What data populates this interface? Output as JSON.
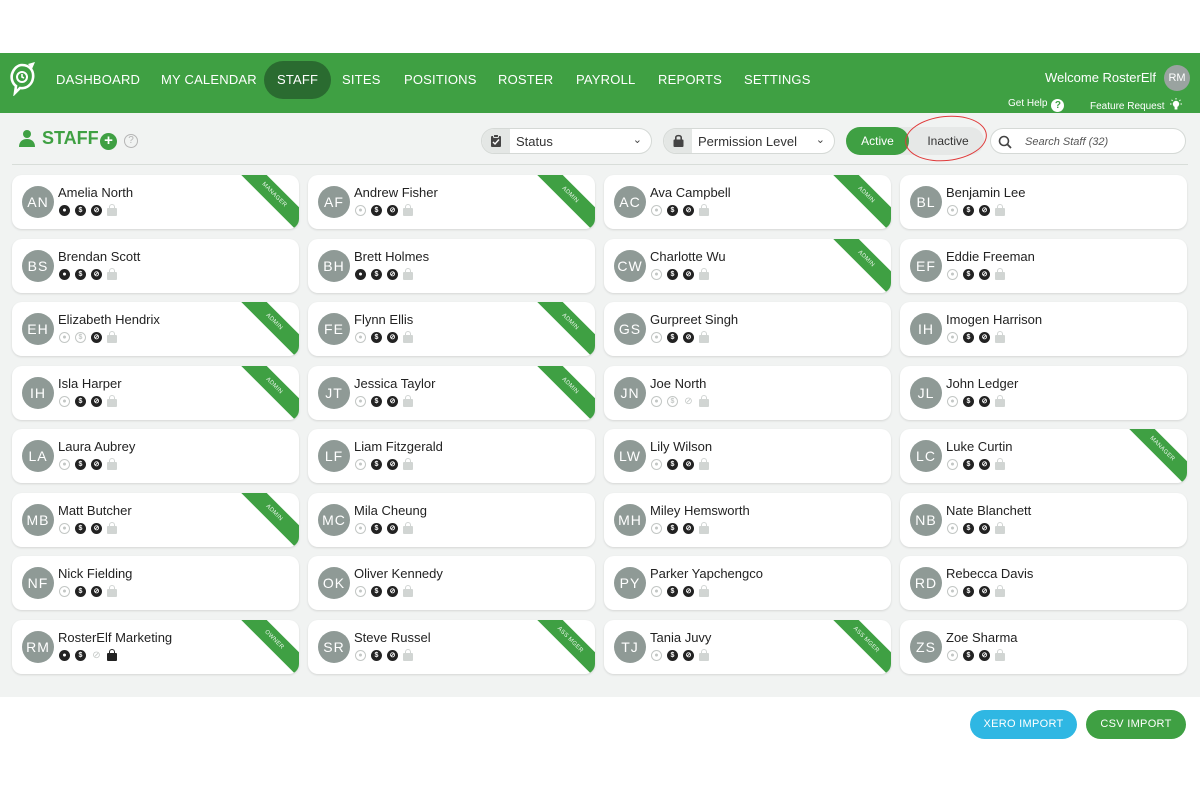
{
  "nav": {
    "items": [
      "DASHBOARD",
      "MY CALENDAR",
      "STAFF",
      "SITES",
      "POSITIONS",
      "ROSTER",
      "PAYROLL",
      "REPORTS",
      "SETTINGS"
    ],
    "active": "STAFF",
    "welcome": "Welcome RosterElf",
    "avatar_initials": "RM",
    "get_help": "Get Help",
    "feature_request": "Feature Request"
  },
  "toolbar": {
    "title": "STAFF",
    "status_label": "Status",
    "permission_label": "Permission Level",
    "active_label": "Active",
    "inactive_label": "Inactive",
    "search_placeholder": "Search Staff (32)"
  },
  "staff": [
    {
      "initials": "AN",
      "name": "Amelia North",
      "icons": [
        "on",
        "on",
        "on",
        "lock-off"
      ],
      "ribbon": "MANAGER"
    },
    {
      "initials": "AF",
      "name": "Andrew Fisher",
      "icons": [
        "off",
        "on",
        "on",
        "lock-off"
      ],
      "ribbon": "ADMIN"
    },
    {
      "initials": "AC",
      "name": "Ava Campbell",
      "icons": [
        "off",
        "on",
        "on",
        "lock-off"
      ],
      "ribbon": "ADMIN"
    },
    {
      "initials": "BL",
      "name": "Benjamin Lee",
      "icons": [
        "off",
        "on",
        "on",
        "lock-off"
      ],
      "ribbon": ""
    },
    {
      "initials": "BS",
      "name": "Brendan Scott",
      "icons": [
        "on",
        "on",
        "on",
        "lock-off"
      ],
      "ribbon": ""
    },
    {
      "initials": "BH",
      "name": "Brett Holmes",
      "icons": [
        "on",
        "on",
        "on",
        "lock-off"
      ],
      "ribbon": ""
    },
    {
      "initials": "CW",
      "name": "Charlotte Wu",
      "icons": [
        "off",
        "on",
        "on",
        "lock-off"
      ],
      "ribbon": "ADMIN"
    },
    {
      "initials": "EF",
      "name": "Eddie Freeman",
      "icons": [
        "off",
        "on",
        "on",
        "lock-off"
      ],
      "ribbon": ""
    },
    {
      "initials": "EH",
      "name": "Elizabeth Hendrix",
      "icons": [
        "off",
        "off",
        "on",
        "lock-off"
      ],
      "ribbon": "ADMIN"
    },
    {
      "initials": "FE",
      "name": "Flynn Ellis",
      "icons": [
        "off",
        "on",
        "on",
        "lock-off"
      ],
      "ribbon": "ADMIN"
    },
    {
      "initials": "GS",
      "name": "Gurpreet Singh",
      "icons": [
        "off",
        "on",
        "on",
        "lock-off"
      ],
      "ribbon": ""
    },
    {
      "initials": "IH",
      "name": "Imogen Harrison",
      "icons": [
        "off",
        "on",
        "on",
        "lock-off"
      ],
      "ribbon": ""
    },
    {
      "initials": "IH",
      "name": "Isla Harper",
      "icons": [
        "off",
        "on",
        "on",
        "lock-off"
      ],
      "ribbon": "ADMIN"
    },
    {
      "initials": "JT",
      "name": "Jessica Taylor",
      "icons": [
        "off",
        "on",
        "on",
        "lock-off"
      ],
      "ribbon": "ADMIN"
    },
    {
      "initials": "JN",
      "name": "Joe North",
      "icons": [
        "off",
        "off",
        "na",
        "lock-off"
      ],
      "ribbon": ""
    },
    {
      "initials": "JL",
      "name": "John Ledger",
      "icons": [
        "off",
        "on",
        "on",
        "lock-off"
      ],
      "ribbon": ""
    },
    {
      "initials": "LA",
      "name": "Laura Aubrey",
      "icons": [
        "off",
        "on",
        "on",
        "lock-off"
      ],
      "ribbon": ""
    },
    {
      "initials": "LF",
      "name": "Liam Fitzgerald",
      "icons": [
        "off",
        "on",
        "on",
        "lock-off"
      ],
      "ribbon": ""
    },
    {
      "initials": "LW",
      "name": "Lily Wilson",
      "icons": [
        "off",
        "on",
        "on",
        "lock-off"
      ],
      "ribbon": ""
    },
    {
      "initials": "LC",
      "name": "Luke Curtin",
      "icons": [
        "off",
        "on",
        "on",
        "lock-off"
      ],
      "ribbon": "MANAGER"
    },
    {
      "initials": "MB",
      "name": "Matt Butcher",
      "icons": [
        "off",
        "on",
        "on",
        "lock-off"
      ],
      "ribbon": "ADMIN"
    },
    {
      "initials": "MC",
      "name": "Mila Cheung",
      "icons": [
        "off",
        "on",
        "on",
        "lock-off"
      ],
      "ribbon": ""
    },
    {
      "initials": "MH",
      "name": "Miley Hemsworth",
      "icons": [
        "off",
        "on",
        "on",
        "lock-off"
      ],
      "ribbon": ""
    },
    {
      "initials": "NB",
      "name": "Nate Blanchett",
      "icons": [
        "off",
        "on",
        "on",
        "lock-off"
      ],
      "ribbon": ""
    },
    {
      "initials": "NF",
      "name": "Nick Fielding",
      "icons": [
        "off",
        "on",
        "on",
        "lock-off"
      ],
      "ribbon": ""
    },
    {
      "initials": "OK",
      "name": "Oliver Kennedy",
      "icons": [
        "off",
        "on",
        "on",
        "lock-off"
      ],
      "ribbon": ""
    },
    {
      "initials": "PY",
      "name": "Parker Yapchengco",
      "icons": [
        "off",
        "on",
        "on",
        "lock-off"
      ],
      "ribbon": ""
    },
    {
      "initials": "RD",
      "name": "Rebecca Davis",
      "icons": [
        "off",
        "on",
        "on",
        "lock-off"
      ],
      "ribbon": ""
    },
    {
      "initials": "RM",
      "name": "RosterElf Marketing",
      "icons": [
        "on",
        "on",
        "na",
        "lock-on"
      ],
      "ribbon": "OWNER"
    },
    {
      "initials": "SR",
      "name": "Steve Russel",
      "icons": [
        "off",
        "on",
        "on",
        "lock-off"
      ],
      "ribbon": "ASS MGER"
    },
    {
      "initials": "TJ",
      "name": "Tania Juvy",
      "icons": [
        "off",
        "on",
        "on",
        "lock-off"
      ],
      "ribbon": "ASS MGER"
    },
    {
      "initials": "ZS",
      "name": "Zoe Sharma",
      "icons": [
        "off",
        "on",
        "on",
        "lock-off"
      ],
      "ribbon": ""
    }
  ],
  "footer": {
    "xero_label": "XERO IMPORT",
    "csv_label": "CSV IMPORT"
  },
  "colors": {
    "brand_green": "#3fa043",
    "active_nav": "#2a6b30",
    "xero_blue": "#2fb7e3",
    "annotation_red": "#e03a3a"
  }
}
